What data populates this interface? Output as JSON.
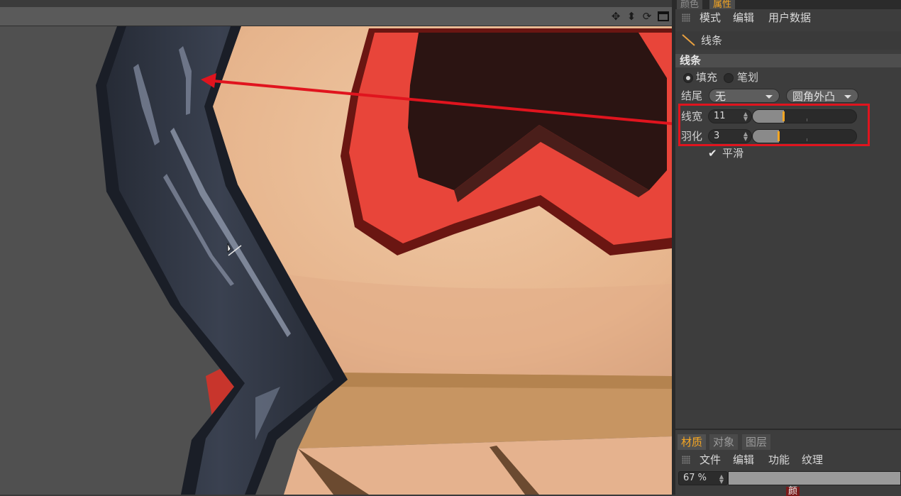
{
  "attributes": {
    "tabs": [
      {
        "label": "颜色",
        "active": false
      },
      {
        "label": "属性",
        "active": true
      }
    ],
    "menu": [
      "模式",
      "编辑",
      "用户数据"
    ],
    "object_name": "线条",
    "section_title": "线条",
    "fill_label": "填充",
    "stroke_label": "笔划",
    "fill_selected": true,
    "end_label": "结尾",
    "end_value": "无",
    "corner_value": "圆角外凸",
    "width_label": "线宽",
    "width_value": "11",
    "width_fraction": 0.3,
    "feather_label": "羽化",
    "feather_value": "3",
    "feather_fraction": 0.25,
    "smooth_label": "平滑",
    "smooth_checked": true
  },
  "material_panel": {
    "tabs": [
      {
        "label": "材质",
        "active": true
      },
      {
        "label": "对象",
        "active": false
      },
      {
        "label": "图层",
        "active": false
      }
    ],
    "menu": [
      "文件",
      "编辑",
      "功能",
      "纹理"
    ],
    "zoom_value": "67 %",
    "bottom_label": "颜"
  },
  "viewport": {
    "tool_icons": [
      "move-icon",
      "move-down-icon",
      "rotate-icon",
      "maximize-icon"
    ]
  },
  "colors": {
    "accent": "#f5a623",
    "highlight": "#e0141e",
    "panel_bg": "#3d3d3d",
    "skin": "#e8b994",
    "goggle_red": "#e8453a",
    "hair": "#333a48"
  }
}
